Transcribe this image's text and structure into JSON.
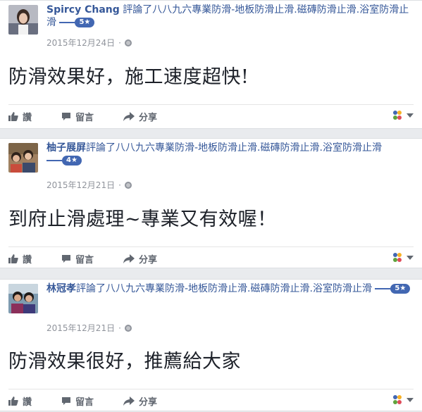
{
  "posts": [
    {
      "author": "Spircy Chang",
      "verb": "評論了",
      "page": "八八九六專業防滑-地板防滑止滑.磁磚防滑止滑.浴室防滑止滑",
      "rating": "5★",
      "date": "2015年12月24日",
      "sep": "·",
      "review": "防滑效果好，施工速度超快!",
      "like": "讚",
      "comment": "留言",
      "share": "分享"
    },
    {
      "author": "柚子展屏",
      "verb": "評論了",
      "page": "八八九六專業防滑-地板防滑止滑.磁磚防滑止滑.浴室防滑止滑",
      "rating": "4★",
      "date": "2015年12月21日",
      "sep": "·",
      "review": "到府止滑處理~專業又有效喔！",
      "like": "讚",
      "comment": "留言",
      "share": "分享"
    },
    {
      "author": "林冠孝",
      "verb": "評論了",
      "page": "八八九六專業防滑-地板防滑止滑.磁磚防滑止滑.浴室防滑止滑",
      "rating": "5★",
      "date": "2015年12月21日",
      "sep": "·",
      "review": "防滑效果很好，推薦給大家",
      "like": "讚",
      "comment": "留言",
      "share": "分享"
    }
  ],
  "icons": {
    "visibility": "globe-icon",
    "like": "thumbs-up-icon",
    "comment": "comment-icon",
    "share": "share-arrow-icon",
    "reactions": "reaction-selector-icon"
  },
  "colors": {
    "link": "#365899",
    "badge": "#4267b2",
    "meta": "#90949c",
    "action": "#616770",
    "background": "#e9ebee"
  }
}
